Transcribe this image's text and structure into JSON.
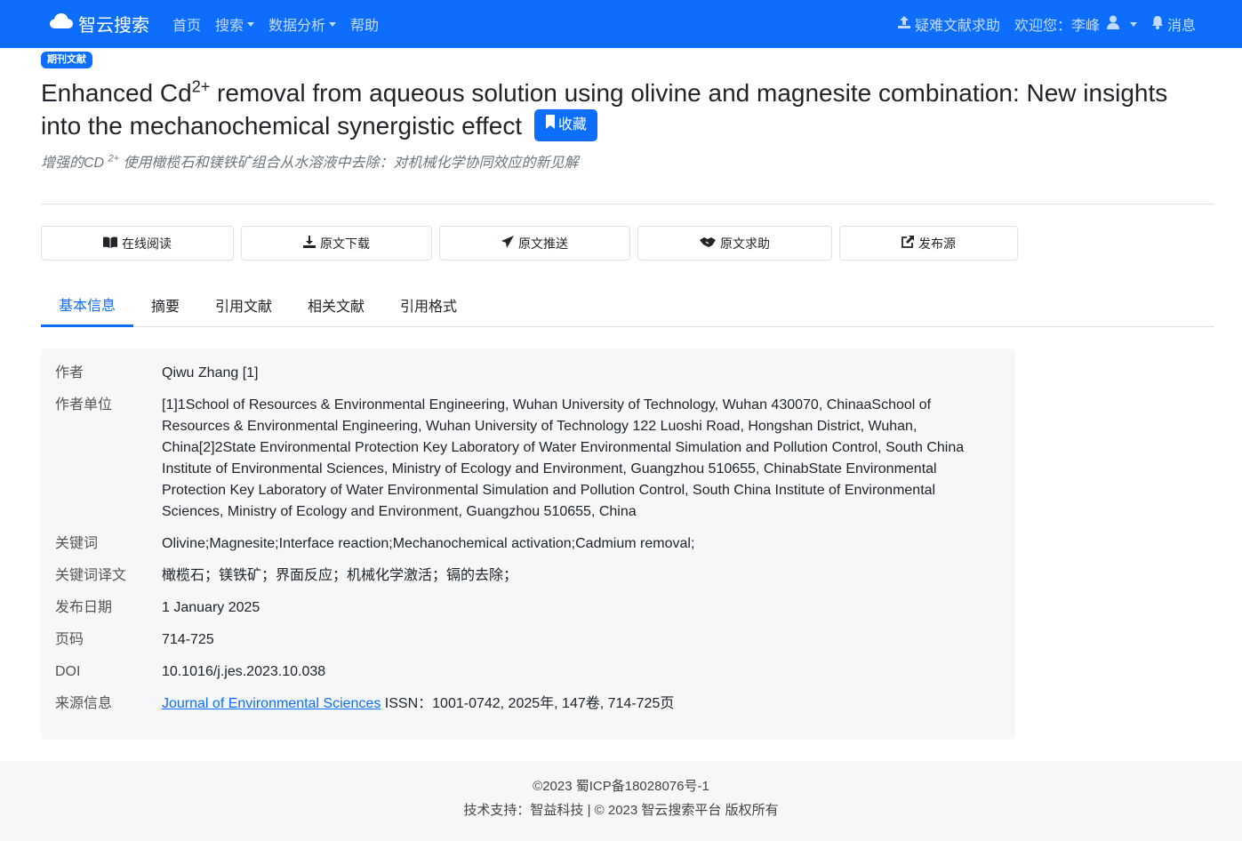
{
  "nav": {
    "brand": "智云搜索",
    "links": [
      "首页",
      "搜索",
      "数据分析",
      "帮助"
    ],
    "help_request": "疑难文献求助",
    "welcome": "欢迎您：李峰",
    "messages": "消息"
  },
  "article": {
    "badge": "期刊文献",
    "title_part1": "Enhanced Cd",
    "title_sup": "2+",
    "title_part2": " removal from aqueous solution using olivine and magnesite combination: New insights into the mechanochemical synergistic effect",
    "favorite": "收藏",
    "subtitle_part1": "增强的CD ",
    "subtitle_sup": "2+",
    "subtitle_part2": " 使用橄榄石和镁铁矿组合从水溶液中去除：对机械化学协同效应的新见解"
  },
  "actions": [
    "在线阅读",
    "原文下载",
    "原文推送",
    "原文求助",
    "发布源"
  ],
  "tabs": [
    "基本信息",
    "摘要",
    "引用文献",
    "相关文献",
    "引用格式"
  ],
  "info": {
    "author_label": "作者",
    "author": "Qiwu Zhang [1]",
    "affiliation_label": "作者单位",
    "affiliation": "[1]1School of Resources & Environmental Engineering, Wuhan University of Technology, Wuhan 430070, ChinaaSchool of Resources & Environmental Engineering, Wuhan University of Technology 122 Luoshi Road, Hongshan District, Wuhan, China[2]2State Environmental Protection Key Laboratory of Water Environmental Simulation and Pollution Control, South China Institute of Environmental Sciences, Ministry of Ecology and Environment, Guangzhou 510655, ChinabState Environmental Protection Key Laboratory of Water Environmental Simulation and Pollution Control, South China Institute of Environmental Sciences, Ministry of Ecology and Environment, Guangzhou 510655, China",
    "keywords_label": "关键词",
    "keywords": "Olivine;Magnesite;Interface reaction;Mechanochemical activation;Cadmium removal;",
    "keywords_cn_label": "关键词译文",
    "keywords_cn": "橄榄石；镁铁矿；界面反应；机械化学激活；镉的去除；",
    "date_label": "发布日期",
    "date": "1 January 2025",
    "pages_label": "页码",
    "pages": "714-725",
    "doi_label": "DOI",
    "doi": "10.1016/j.jes.2023.10.038",
    "source_label": "来源信息",
    "source_journal": "Journal of Environmental Sciences",
    "source_rest": " ISSN：1001-0742, 2025年, 147卷, 714-725页"
  },
  "footer": {
    "icp": "©2023 蜀ICP备18028076号-1",
    "support": "技术支持：智益科技 | © 2023 智云搜索平台 版权所有"
  },
  "colors": {
    "primary": "#0d6efd",
    "panel_bg": "#f6f7f8"
  },
  "icons": [
    "cloud-icon",
    "upload-icon",
    "user-icon",
    "bell-icon",
    "bookmark-icon",
    "book-icon",
    "download-icon",
    "send-icon",
    "handshake-icon",
    "external-link-icon"
  ]
}
